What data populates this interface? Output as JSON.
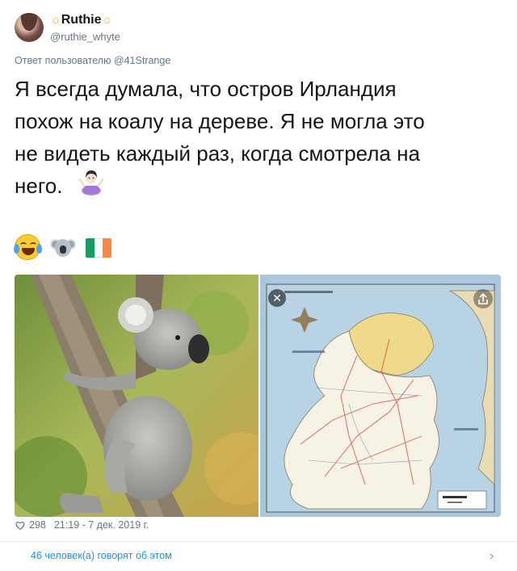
{
  "author": {
    "name": "Ruthie",
    "name_prefix": "☼",
    "name_suffix": "☼",
    "handle": "@ruthie_whyte"
  },
  "reply_to": "Ответ пользователю @41Strange",
  "tweet": {
    "lines": [
      "Я всегда думала, что остров Ирландия",
      "похож на коалу на дереве. Я не могла это",
      "не видеть каждый раз, когда смотрела на",
      "него."
    ],
    "inline_emoji": "woman-shrugging-icon",
    "emoji_row": [
      "face-with-tears-of-joy-icon",
      "koala-icon",
      "ireland-flag-icon"
    ]
  },
  "media": {
    "left_image": "koala-photo",
    "right_image": "ireland-map"
  },
  "stats": {
    "likes": "298",
    "timestamp": "21:19 - 7 дек. 2019 г."
  },
  "footer": {
    "talking_about": "46 человек(а) говорят об этом"
  },
  "colors": {
    "link": "#1b95e0",
    "secondary_text": "#657786",
    "flag_green": "#169b62",
    "flag_white": "#ffffff",
    "flag_orange": "#ff883e"
  }
}
